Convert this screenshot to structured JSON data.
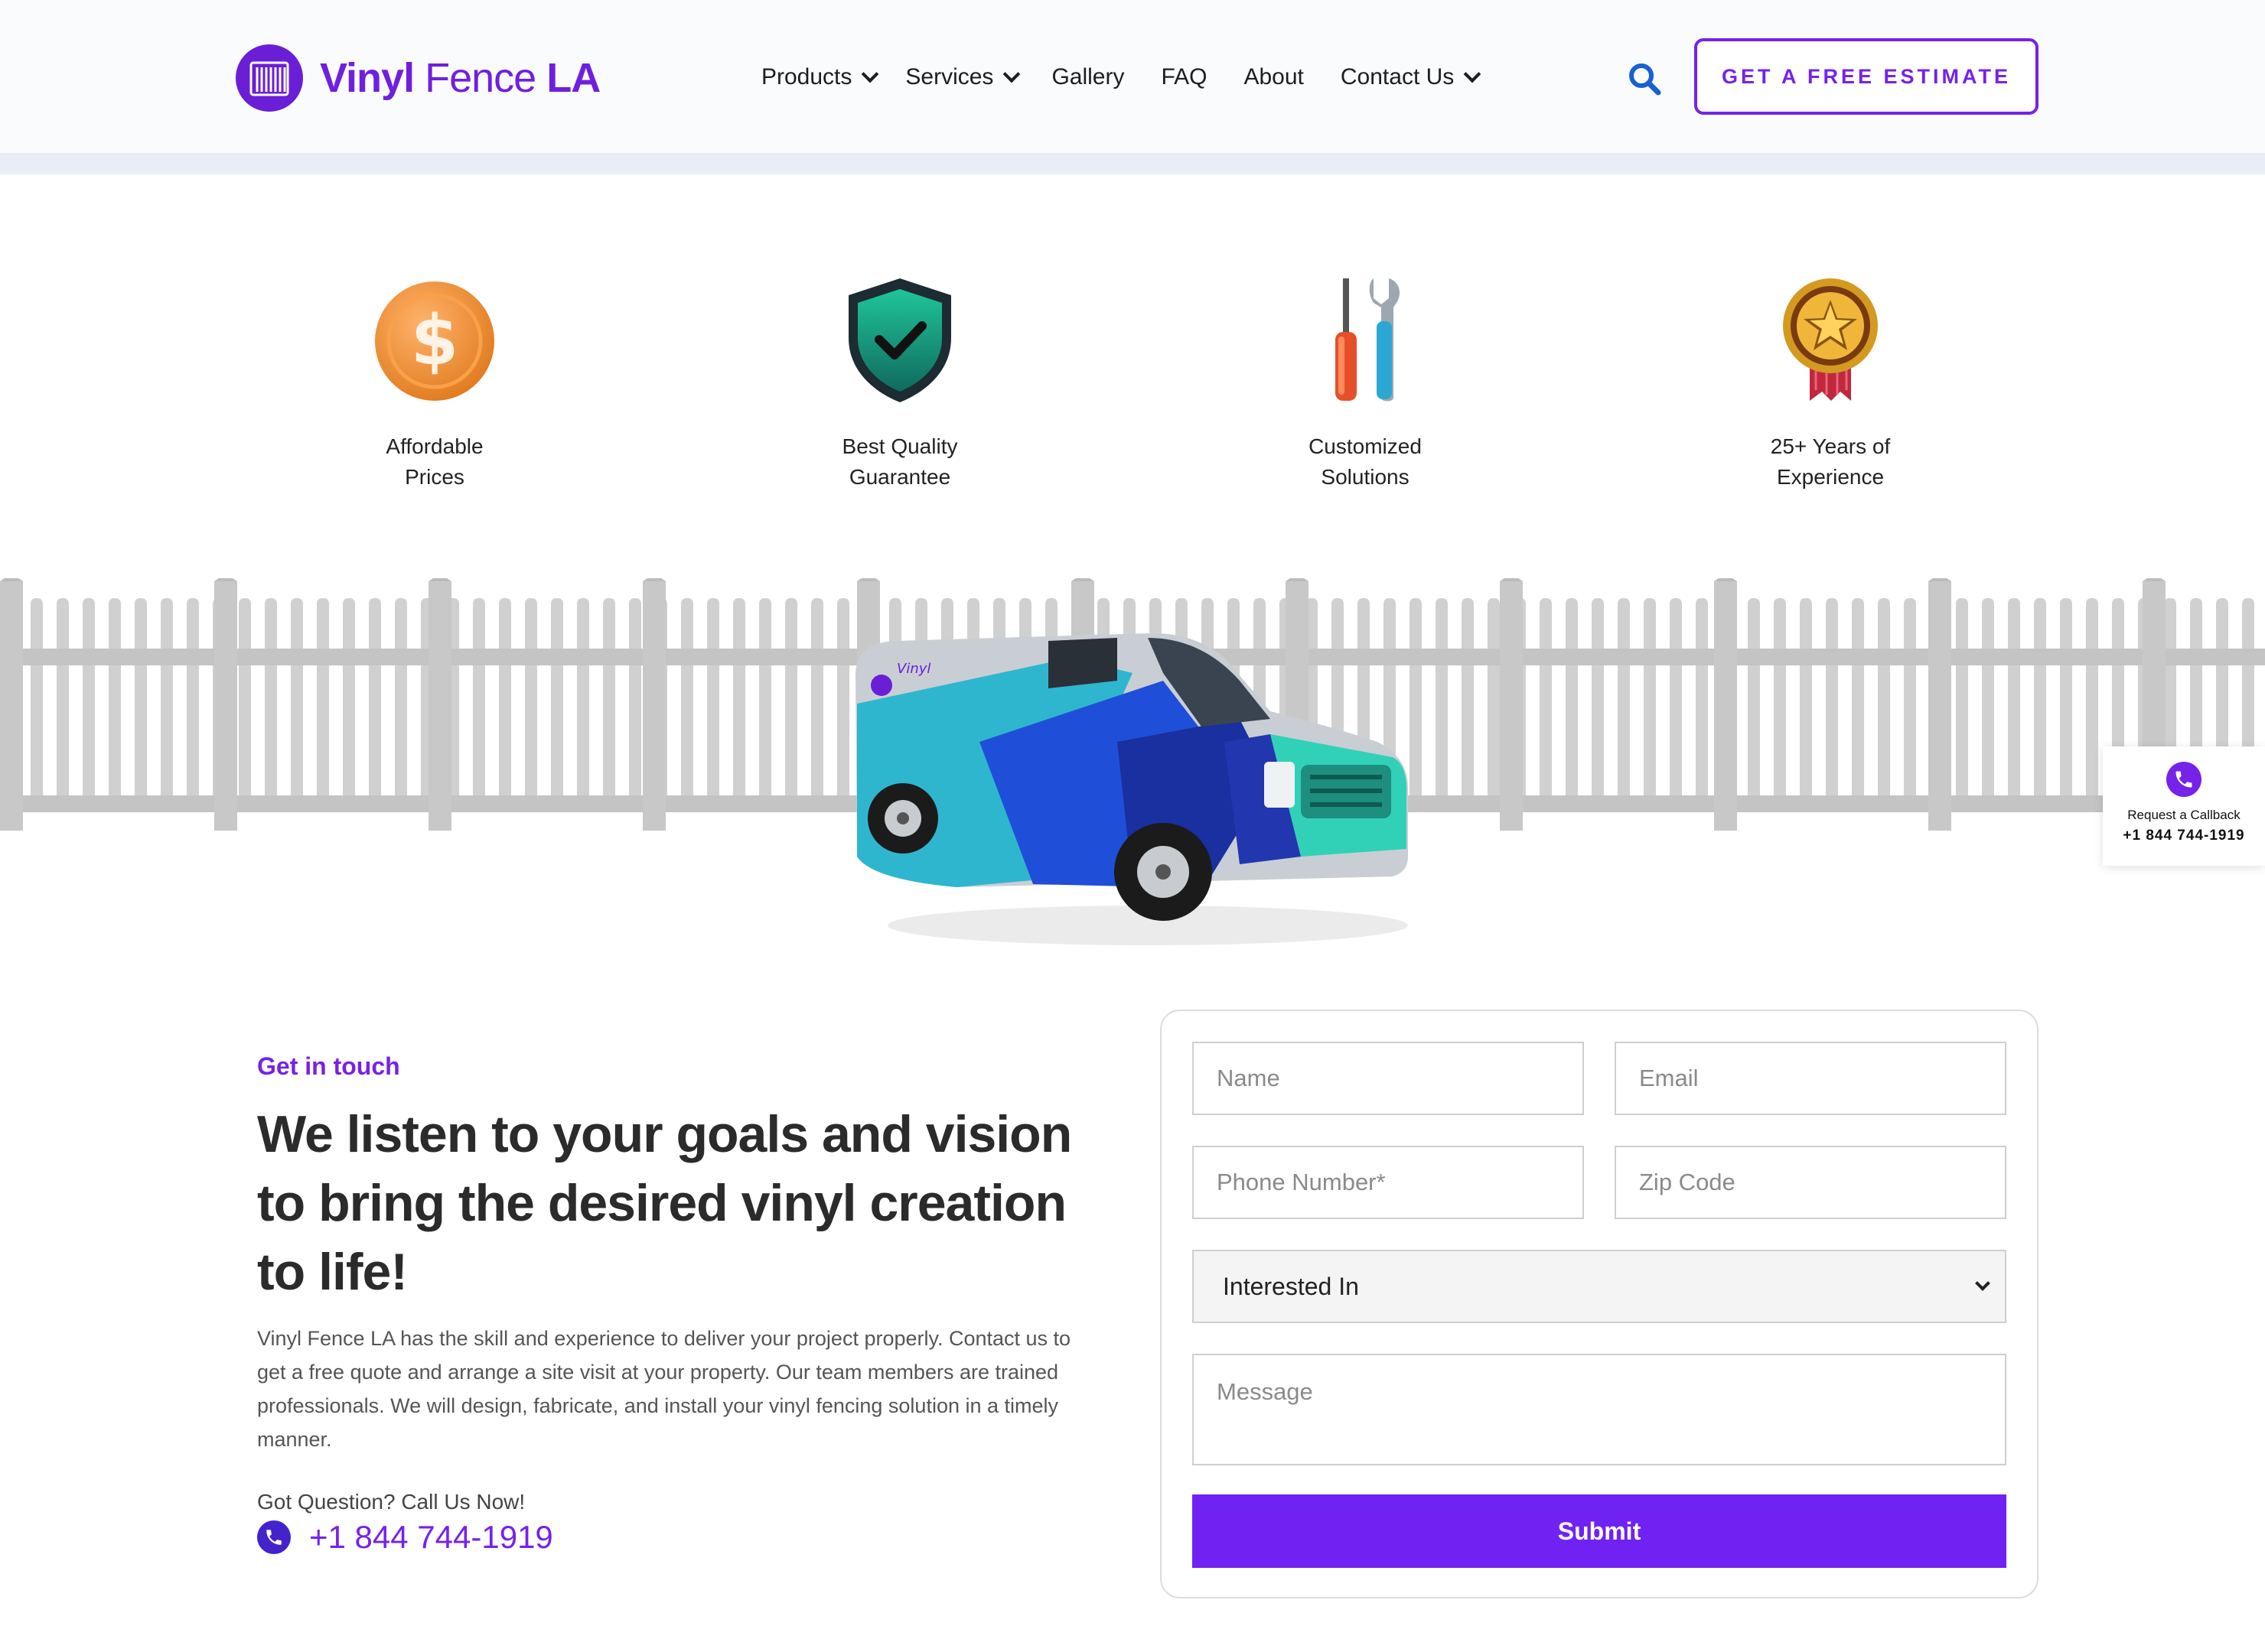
{
  "header": {
    "logo": {
      "word1": "Vinyl",
      "word2": "Fence",
      "word3": "LA"
    },
    "nav": [
      {
        "label": "Products",
        "has_dropdown": true
      },
      {
        "label": "Services",
        "has_dropdown": true
      },
      {
        "label": "Gallery",
        "has_dropdown": false
      },
      {
        "label": "FAQ",
        "has_dropdown": false
      },
      {
        "label": "About",
        "has_dropdown": false
      },
      {
        "label": "Contact Us",
        "has_dropdown": true
      }
    ],
    "search_icon": "search-icon",
    "cta_label": "GET A FREE ESTIMATE"
  },
  "features": [
    {
      "icon": "dollar-coin-icon",
      "label": "Affordable\nPrices"
    },
    {
      "icon": "shield-check-icon",
      "label": "Best Quality\nGuarantee"
    },
    {
      "icon": "tools-icon",
      "label": "Customized\nSolutions"
    },
    {
      "icon": "medal-icon",
      "label": "25+ Years of\nExperience"
    }
  ],
  "callback": {
    "title": "Request a Callback",
    "phone": "+1 844 744-1919"
  },
  "contact": {
    "eyebrow": "Get in touch",
    "headline": "We listen to your goals and vision to bring the desired vinyl creation to life!",
    "body": "Vinyl Fence LA has the skill and experience to deliver your project properly. Contact us to get a free quote and arrange a site visit at your property. Our team members are trained professionals. We will design, fabricate, and install your vinyl fencing solution in a timely manner.",
    "question": "Got Question? Call Us Now!",
    "phone": "+1 844 744-1919"
  },
  "form": {
    "name_placeholder": "Name",
    "email_placeholder": "Email",
    "phone_placeholder": "Phone Number*",
    "zip_placeholder": "Zip Code",
    "interest_selected": "Interested In",
    "message_placeholder": "Message",
    "submit_label": "Submit"
  },
  "colors": {
    "brand": "#7622e8",
    "submit": "#7022f2",
    "search": "#1a5fd4",
    "fence": "#cccccc"
  }
}
